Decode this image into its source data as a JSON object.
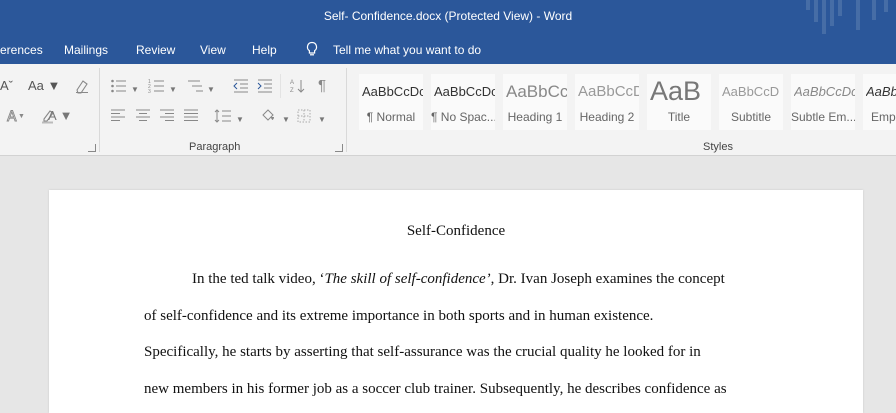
{
  "window": {
    "title": "Self- Confidence.docx (Protected View)  -  Word"
  },
  "menu": {
    "references": "erences",
    "mailings": "Mailings",
    "review": "Review",
    "view": "View",
    "help": "Help",
    "tell_me": "Tell me what you want to do"
  },
  "ribbon": {
    "font_group": {
      "change_case": "Aa",
      "font_color": "A"
    },
    "paragraph_group": {
      "label": "Paragraph"
    },
    "styles_group": {
      "label": "Styles",
      "items": [
        {
          "sample": "AaBbCcDc",
          "name": "¶ Normal"
        },
        {
          "sample": "AaBbCcDc",
          "name": "¶ No Spac..."
        },
        {
          "sample": "AaBbCc",
          "name": "Heading 1"
        },
        {
          "sample": "AaBbCcD",
          "name": "Heading 2"
        },
        {
          "sample": "AaB",
          "name": "Title"
        },
        {
          "sample": "AaBbCcD",
          "name": "Subtitle"
        },
        {
          "sample": "AaBbCcDc",
          "name": "Subtle Em..."
        },
        {
          "sample": "AaBb",
          "name": "Emp"
        }
      ]
    }
  },
  "document": {
    "title": "Self-Confidence",
    "p1_start": "In the ted talk video, ‘",
    "p1_italic": "The skill of self-confidence’",
    "p1_end": ", Dr. Ivan Joseph examines the concept",
    "line2": "of self-confidence and its extreme importance in both sports and in human existence.",
    "line3": "Specifically, he starts by asserting that self-assurance was the crucial quality he looked for in",
    "line4": "new members in his former job as a soccer club trainer. Subsequently, he describes confidence as"
  },
  "icons": {
    "tell_me": "lightbulb-icon",
    "bullets": "bullet-list-icon",
    "numbering": "numbered-list-icon",
    "multilevel": "multilevel-list-icon",
    "decrease_indent": "decrease-indent-icon",
    "increase_indent": "increase-indent-icon",
    "sort": "sort-icon",
    "show_marks": "pilcrow-icon",
    "align_left": "align-left-icon",
    "center": "align-center-icon",
    "align_right": "align-right-icon",
    "justify": "justify-icon",
    "line_spacing": "line-spacing-icon",
    "shading": "shading-bucket-icon",
    "borders": "borders-icon",
    "clear_formatting": "clear-formatting-icon",
    "text_effects": "text-effects-icon",
    "highlight": "highlighter-icon"
  },
  "colors": {
    "title_bar": "#2b579a",
    "ribbon": "#f3f3f3",
    "canvas": "#e6e6e6",
    "page": "#ffffff"
  }
}
